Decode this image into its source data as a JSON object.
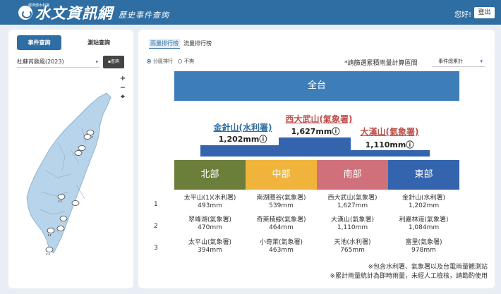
{
  "header": {
    "org": "經濟部水利署",
    "title": "水文資訊網",
    "subtitle": "歷史事件查詢",
    "greeting": "您好!",
    "logout_label": "登出"
  },
  "sidebar": {
    "tabs": [
      {
        "label": "事件查詢",
        "active": true
      },
      {
        "label": "測站查詢",
        "active": false
      }
    ],
    "event_value": "杜蘇芮颱風(2023)",
    "query_label": "查詢",
    "zoom_in": "+",
    "zoom_out": "−",
    "locate": "⌖"
  },
  "main": {
    "tabs": [
      {
        "label": "雨量排行榜",
        "active": true
      },
      {
        "label": "流量排行榜",
        "active": false
      }
    ],
    "radio_options": [
      {
        "label": "分區排行",
        "checked": true
      },
      {
        "label": "不拘",
        "checked": false
      }
    ],
    "hint": "*請篩選累積雨量計算區間",
    "range_value": "事件總累計",
    "overall_label": "全台",
    "podium": [
      {
        "name": "西大武山(氣象署)",
        "value": "1,627mm",
        "color": "#c0504d",
        "place": 1
      },
      {
        "name": "金針山(水利署)",
        "value": "1,202mm",
        "color": "#2f6ea3",
        "place": 2
      },
      {
        "name": "大漢山(氣象署)",
        "value": "1,110mm",
        "color": "#c0504d",
        "place": 3
      }
    ],
    "info_icon": "ⓘ",
    "regions": [
      {
        "label": "北部",
        "color": "#6b7e3a"
      },
      {
        "label": "中部",
        "color": "#f0b43c"
      },
      {
        "label": "南部",
        "color": "#d0707a"
      },
      {
        "label": "東部",
        "color": "#3364ad"
      }
    ],
    "ranks": [
      {
        "rank": "1",
        "cells": [
          {
            "name": "太平山(1)(水利署)",
            "value": "493mm"
          },
          {
            "name": "南湖圈谷(氣象署)",
            "value": "539mm"
          },
          {
            "name": "西大武山(氣象署)",
            "value": "1,627mm"
          },
          {
            "name": "金針山(水利署)",
            "value": "1,202mm"
          }
        ]
      },
      {
        "rank": "2",
        "cells": [
          {
            "name": "翠峰湖(氣象署)",
            "value": "470mm"
          },
          {
            "name": "奇萊稜線(氣象署)",
            "value": "464mm"
          },
          {
            "name": "大漢山(氣象署)",
            "value": "1,110mm"
          },
          {
            "name": "利嘉林道(氣象署)",
            "value": "1,084mm"
          }
        ]
      },
      {
        "rank": "3",
        "cells": [
          {
            "name": "太平山(氣象署)",
            "value": "394mm"
          },
          {
            "name": "小奇萊(氣象署)",
            "value": "463mm"
          },
          {
            "name": "天池(水利署)",
            "value": "765mm"
          },
          {
            "name": "富里(氣象署)",
            "value": "978mm"
          }
        ]
      }
    ],
    "notes": [
      "※包含水利署、氣象署以及台電雨量觀測站",
      "※累計雨量統計為即時雨量，未經人工檢核，請勘酌使用"
    ]
  }
}
